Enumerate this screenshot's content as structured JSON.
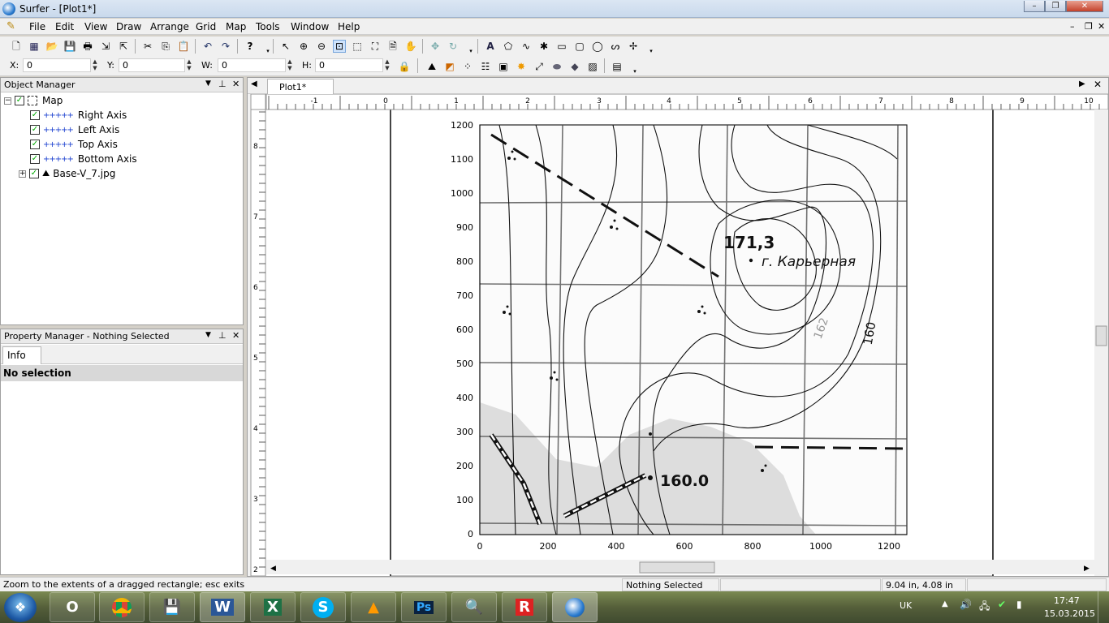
{
  "window": {
    "title": "Surfer - [Plot1*]",
    "controls": [
      "–",
      "❐",
      "✕"
    ],
    "mdi_controls": [
      "–",
      "❐",
      "✕"
    ]
  },
  "menu": [
    "File",
    "Edit",
    "View",
    "Draw",
    "Arrange",
    "Grid",
    "Map",
    "Tools",
    "Window",
    "Help"
  ],
  "coords": {
    "x_label": "X:",
    "x_value": "0",
    "y_label": "Y:",
    "y_value": "0",
    "w_label": "W:",
    "w_value": "0",
    "h_label": "H:",
    "h_value": "0"
  },
  "object_manager": {
    "title": "Object Manager",
    "root": "Map",
    "items": [
      "Right Axis",
      "Left Axis",
      "Top Axis",
      "Bottom Axis",
      "Base-V_7.jpg"
    ]
  },
  "property_manager": {
    "title": "Property Manager - Nothing Selected",
    "tab": "Info",
    "selection": "No selection"
  },
  "doc_tab": {
    "label": "Plot1*"
  },
  "ruler": {
    "top": [
      "-1",
      "0",
      "1",
      "2",
      "3",
      "4",
      "5",
      "6",
      "7",
      "8",
      "9",
      "10"
    ],
    "left": [
      "8",
      "7",
      "6",
      "5",
      "4",
      "3",
      "2"
    ]
  },
  "map": {
    "y_ticks": [
      "1200",
      "1100",
      "1000",
      "900",
      "800",
      "700",
      "600",
      "500",
      "400",
      "300",
      "200",
      "100",
      "0"
    ],
    "x_ticks": [
      "0",
      "200",
      "400",
      "600",
      "800",
      "1000",
      "1200"
    ],
    "labels": {
      "peak": "171,3",
      "hill_name": "г. Карьерная",
      "elev_low": "160.0",
      "contour": "160",
      "contour_faint": "162"
    }
  },
  "status": {
    "hint": "Zoom to the extents of a dragged rectangle; esc exits",
    "selection": "Nothing Selected",
    "position": "9.04 in, 4.08 in"
  },
  "taskbar": {
    "apps": [
      "O",
      "W",
      "X",
      "S",
      "Ps",
      "R"
    ],
    "lang": "UK",
    "time": "17:47",
    "date": "15.03.2015"
  },
  "colors": {
    "axis_icon": "#1a3fcf",
    "title_bg": "#c9d9ec"
  }
}
